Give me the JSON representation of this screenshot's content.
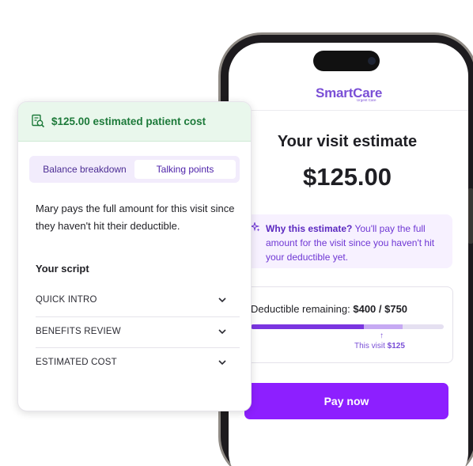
{
  "phone": {
    "logo": "SmartCare",
    "logo_sub": "Urgent Care",
    "title": "Your visit estimate",
    "amount": "$125.00",
    "why": {
      "heading": "Why this estimate?",
      "body": " You'll pay the full amount for the visit since you haven't hit your deductible yet."
    },
    "deductible": {
      "label": "Deductible remaining: ",
      "value": "$400 / $750",
      "used_fraction": 0.587,
      "visit_fraction": 0.2
    },
    "visit_note": {
      "prefix": "This visit ",
      "amount": "$125",
      "arrow": "↑"
    },
    "pay_button": "Pay now"
  },
  "card": {
    "banner": "$125.00 estimated patient cost",
    "tabs": [
      {
        "label": "Balance breakdown",
        "active": false
      },
      {
        "label": "Talking points",
        "active": true
      }
    ],
    "summary": "Mary pays the full amount for this visit since they haven't hit their deductible.",
    "script_title": "Your script",
    "sections": [
      {
        "label": "QUICK INTRO"
      },
      {
        "label": "BENEFITS REVIEW"
      },
      {
        "label": "ESTIMATED COST"
      }
    ]
  },
  "colors": {
    "brand_purple": "#8d1fff",
    "banner_green": "#1d7a3a",
    "banner_bg": "#e9f7ec"
  },
  "icons": {
    "banner": "receipt-search-icon",
    "why": "sparkle-icon",
    "accordion": "chevron-down-icon"
  }
}
